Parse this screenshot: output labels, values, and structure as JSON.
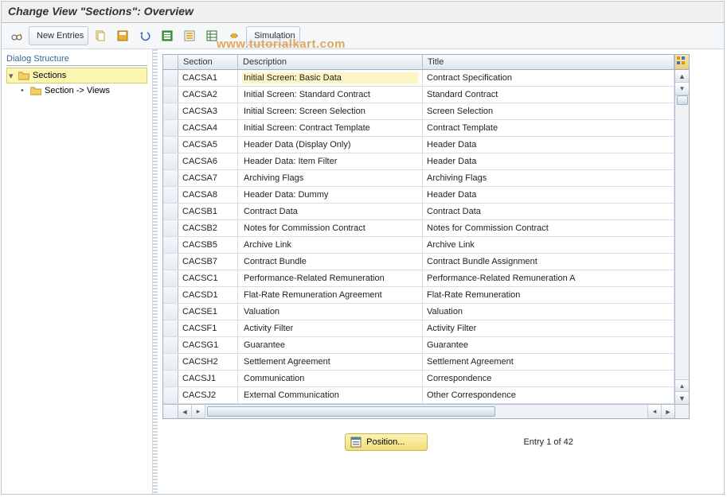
{
  "title": "Change View \"Sections\": Overview",
  "watermark": "www.tutorialkart.com",
  "toolbar": {
    "new_entries_label": "New Entries",
    "simulation_label": "Simulation"
  },
  "sidebar": {
    "panel_title": "Dialog Structure",
    "nodes": [
      {
        "label": "Sections",
        "expanded": true,
        "selected": true
      },
      {
        "label": "Section -> Views",
        "expanded": false,
        "selected": false
      }
    ]
  },
  "table": {
    "columns": {
      "section": "Section",
      "description": "Description",
      "title": "Title"
    },
    "rows": [
      {
        "section": "CACSA1",
        "description": "Initial Screen: Basic Data",
        "title": "Contract Specification"
      },
      {
        "section": "CACSA2",
        "description": "Initial Screen: Standard Contract",
        "title": "Standard Contract"
      },
      {
        "section": "CACSA3",
        "description": "Initial Screen: Screen Selection",
        "title": "Screen Selection"
      },
      {
        "section": "CACSA4",
        "description": "Initial Screen: Contract Template",
        "title": "Contract Template"
      },
      {
        "section": "CACSA5",
        "description": "Header Data (Display Only)",
        "title": "Header Data"
      },
      {
        "section": "CACSA6",
        "description": "Header Data: Item Filter",
        "title": "Header Data"
      },
      {
        "section": "CACSA7",
        "description": "Archiving Flags",
        "title": "Archiving Flags"
      },
      {
        "section": "CACSA8",
        "description": "Header Data: Dummy",
        "title": "Header Data"
      },
      {
        "section": "CACSB1",
        "description": "Contract Data",
        "title": "Contract Data"
      },
      {
        "section": "CACSB2",
        "description": "Notes for Commission Contract",
        "title": "Notes for Commission Contract"
      },
      {
        "section": "CACSB5",
        "description": "Archive Link",
        "title": "Archive Link"
      },
      {
        "section": "CACSB7",
        "description": "Contract Bundle",
        "title": "Contract Bundle Assignment"
      },
      {
        "section": "CACSC1",
        "description": "Performance-Related Remuneration",
        "title": "Performance-Related Remuneration A"
      },
      {
        "section": "CACSD1",
        "description": "Flat-Rate Remuneration Agreement",
        "title": "Flat-Rate Remuneration"
      },
      {
        "section": "CACSE1",
        "description": "Valuation",
        "title": "Valuation"
      },
      {
        "section": "CACSF1",
        "description": "Activity Filter",
        "title": "Activity Filter"
      },
      {
        "section": "CACSG1",
        "description": "Guarantee",
        "title": "Guarantee"
      },
      {
        "section": "CACSH2",
        "description": "Settlement Agreement",
        "title": "Settlement Agreement"
      },
      {
        "section": "CACSJ1",
        "description": "Communication",
        "title": "Correspondence"
      },
      {
        "section": "CACSJ2",
        "description": "External Communication",
        "title": "Other Correspondence"
      }
    ]
  },
  "footer": {
    "position_label": "Position...",
    "entry_text": "Entry 1 of 42"
  },
  "colors": {
    "highlight_bg": "#fdf6b2",
    "gold_button": "#f2de7a",
    "header_gradient_top": "#f8fafc",
    "header_gradient_bot": "#dde6ee"
  }
}
